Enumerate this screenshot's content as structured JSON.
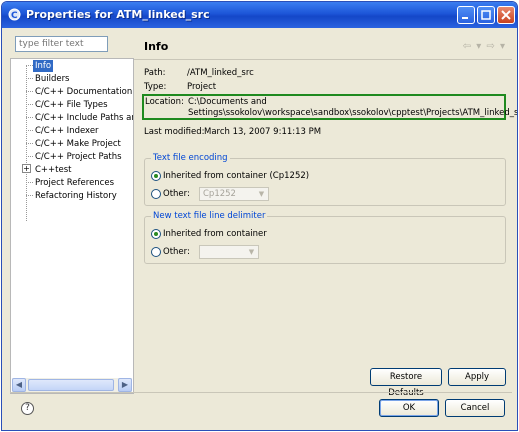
{
  "window": {
    "title": "Properties for ATM_linked_src"
  },
  "filter": {
    "placeholder": "type filter text"
  },
  "tree": {
    "items": [
      "Info",
      "Builders",
      "C/C++ Documentation",
      "C/C++ File Types",
      "C/C++ Include Paths and",
      "C/C++ Indexer",
      "C/C++ Make Project",
      "C/C++ Project Paths",
      "C++test",
      "Project References",
      "Refactoring History"
    ],
    "selected": "Info"
  },
  "page": {
    "title": "Info",
    "path_label": "Path:",
    "path_value": "/ATM_linked_src",
    "type_label": "Type:",
    "type_value": "Project",
    "location_label": "Location:",
    "location_line1": "C:\\Documents and",
    "location_line2": "Settings\\ssokolov\\workspace\\sandbox\\ssokolov\\cpptest\\Projects\\ATM_linked_src",
    "modified_label": "Last modified:",
    "modified_value": "March 13, 2007 9:11:13 PM"
  },
  "encoding": {
    "title": "Text file encoding",
    "inherited": "Inherited from container (Cp1252)",
    "other": "Other:",
    "other_value": "Cp1252"
  },
  "delimiter": {
    "title": "New text file line delimiter",
    "inherited": "Inherited from container",
    "other": "Other:",
    "other_value": ""
  },
  "buttons": {
    "restore": "Restore Defaults",
    "apply": "Apply",
    "ok": "OK",
    "cancel": "Cancel",
    "help": "?"
  },
  "colors": {
    "titlebar": "#1c55d8",
    "selection": "#316ac5",
    "highlight_box": "#1f8a1f",
    "group_title": "#0046d5"
  }
}
